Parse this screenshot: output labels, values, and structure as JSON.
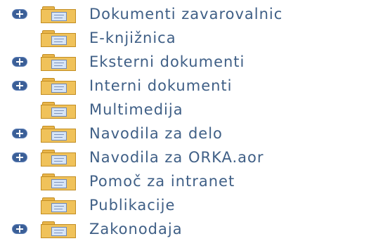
{
  "tree": {
    "items": [
      {
        "label": "Dokumenti zavarovalnic",
        "expandable": true
      },
      {
        "label": "E-knjižnica",
        "expandable": false
      },
      {
        "label": "Eksterni dokumenti",
        "expandable": true
      },
      {
        "label": "Interni dokumenti",
        "expandable": true
      },
      {
        "label": "Multimedija",
        "expandable": false
      },
      {
        "label": "Navodila za delo",
        "expandable": true
      },
      {
        "label": "Navodila za ORKA.aor",
        "expandable": true
      },
      {
        "label": "Pomoč za intranet",
        "expandable": false
      },
      {
        "label": "Publikacije",
        "expandable": false
      },
      {
        "label": "Zakonodaja",
        "expandable": true
      }
    ]
  },
  "icons": {
    "expand": "plus-expander-icon",
    "folder": "folder-with-document-icon"
  },
  "colors": {
    "label_text": "#3f5f86",
    "expander": "#3b5f97",
    "folder": "#f0c25a"
  }
}
